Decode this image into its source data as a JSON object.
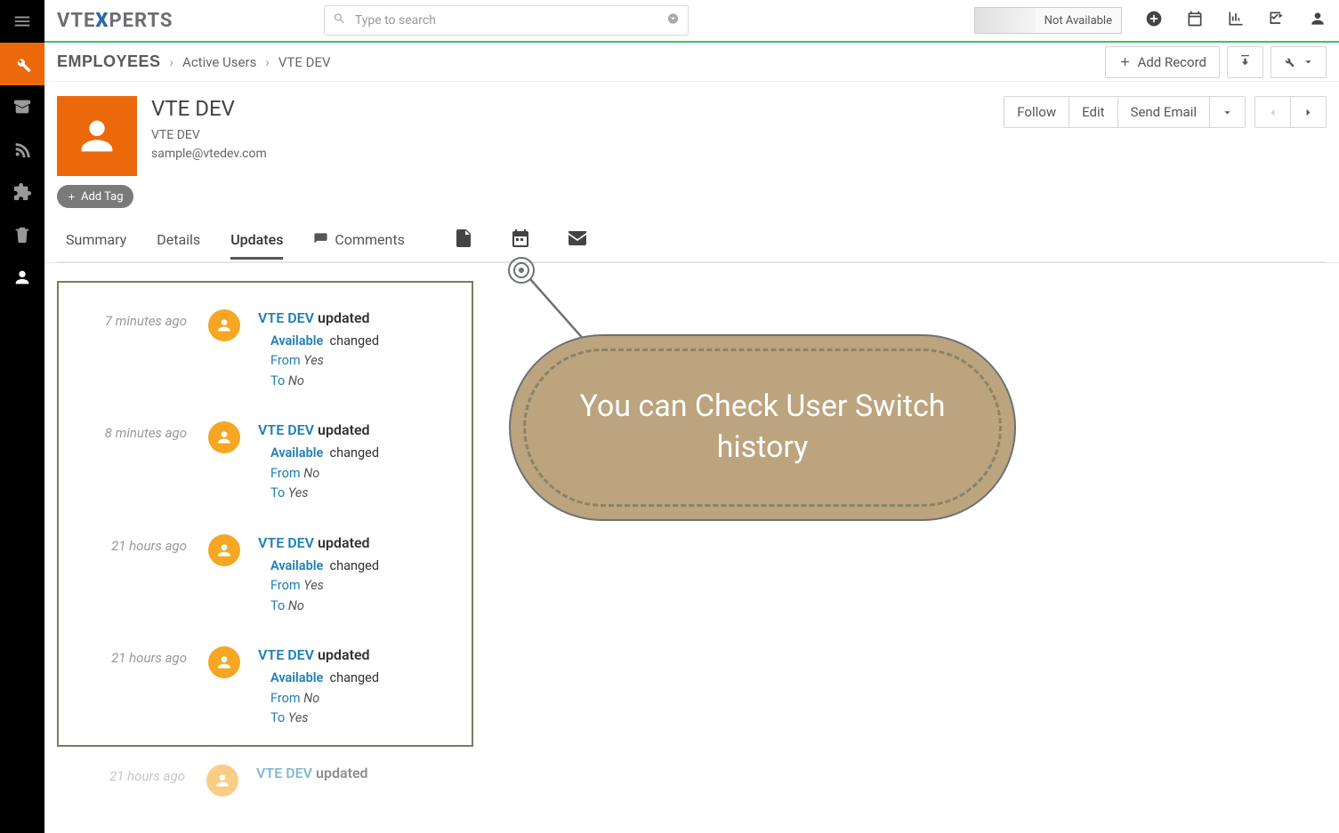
{
  "logo": {
    "pre": "VTE",
    "x": "X",
    "post": "PERTS"
  },
  "search": {
    "placeholder": "Type to search"
  },
  "availability": {
    "label": "Not Available"
  },
  "breadcrumb": {
    "root": "EMPLOYEES",
    "mid": "Active Users",
    "leaf": "VTE DEV"
  },
  "actions": {
    "add_record": "Add Record"
  },
  "record": {
    "title": "VTE DEV",
    "subtitle": "VTE DEV",
    "email": "sample@vtedev.com",
    "add_tag": "Add Tag",
    "follow": "Follow",
    "edit": "Edit",
    "send_email": "Send Email"
  },
  "tabs": {
    "summary": "Summary",
    "details": "Details",
    "updates": "Updates",
    "comments": "Comments"
  },
  "updates": [
    {
      "time": "7 minutes ago",
      "user": "VTE DEV",
      "action": "updated",
      "field": "Available",
      "verb": "changed",
      "from": "Yes",
      "to": "No"
    },
    {
      "time": "8 minutes ago",
      "user": "VTE DEV",
      "action": "updated",
      "field": "Available",
      "verb": "changed",
      "from": "No",
      "to": "Yes"
    },
    {
      "time": "21 hours ago",
      "user": "VTE DEV",
      "action": "updated",
      "field": "Available",
      "verb": "changed",
      "from": "Yes",
      "to": "No"
    },
    {
      "time": "21 hours ago",
      "user": "VTE DEV",
      "action": "updated",
      "field": "Available",
      "verb": "changed",
      "from": "No",
      "to": "Yes"
    }
  ],
  "pending_update": {
    "time": "21 hours ago",
    "user": "VTE DEV",
    "action": "updated"
  },
  "labels": {
    "from": "From",
    "to": "To"
  },
  "callout": {
    "text": "You can Check User Switch history"
  }
}
